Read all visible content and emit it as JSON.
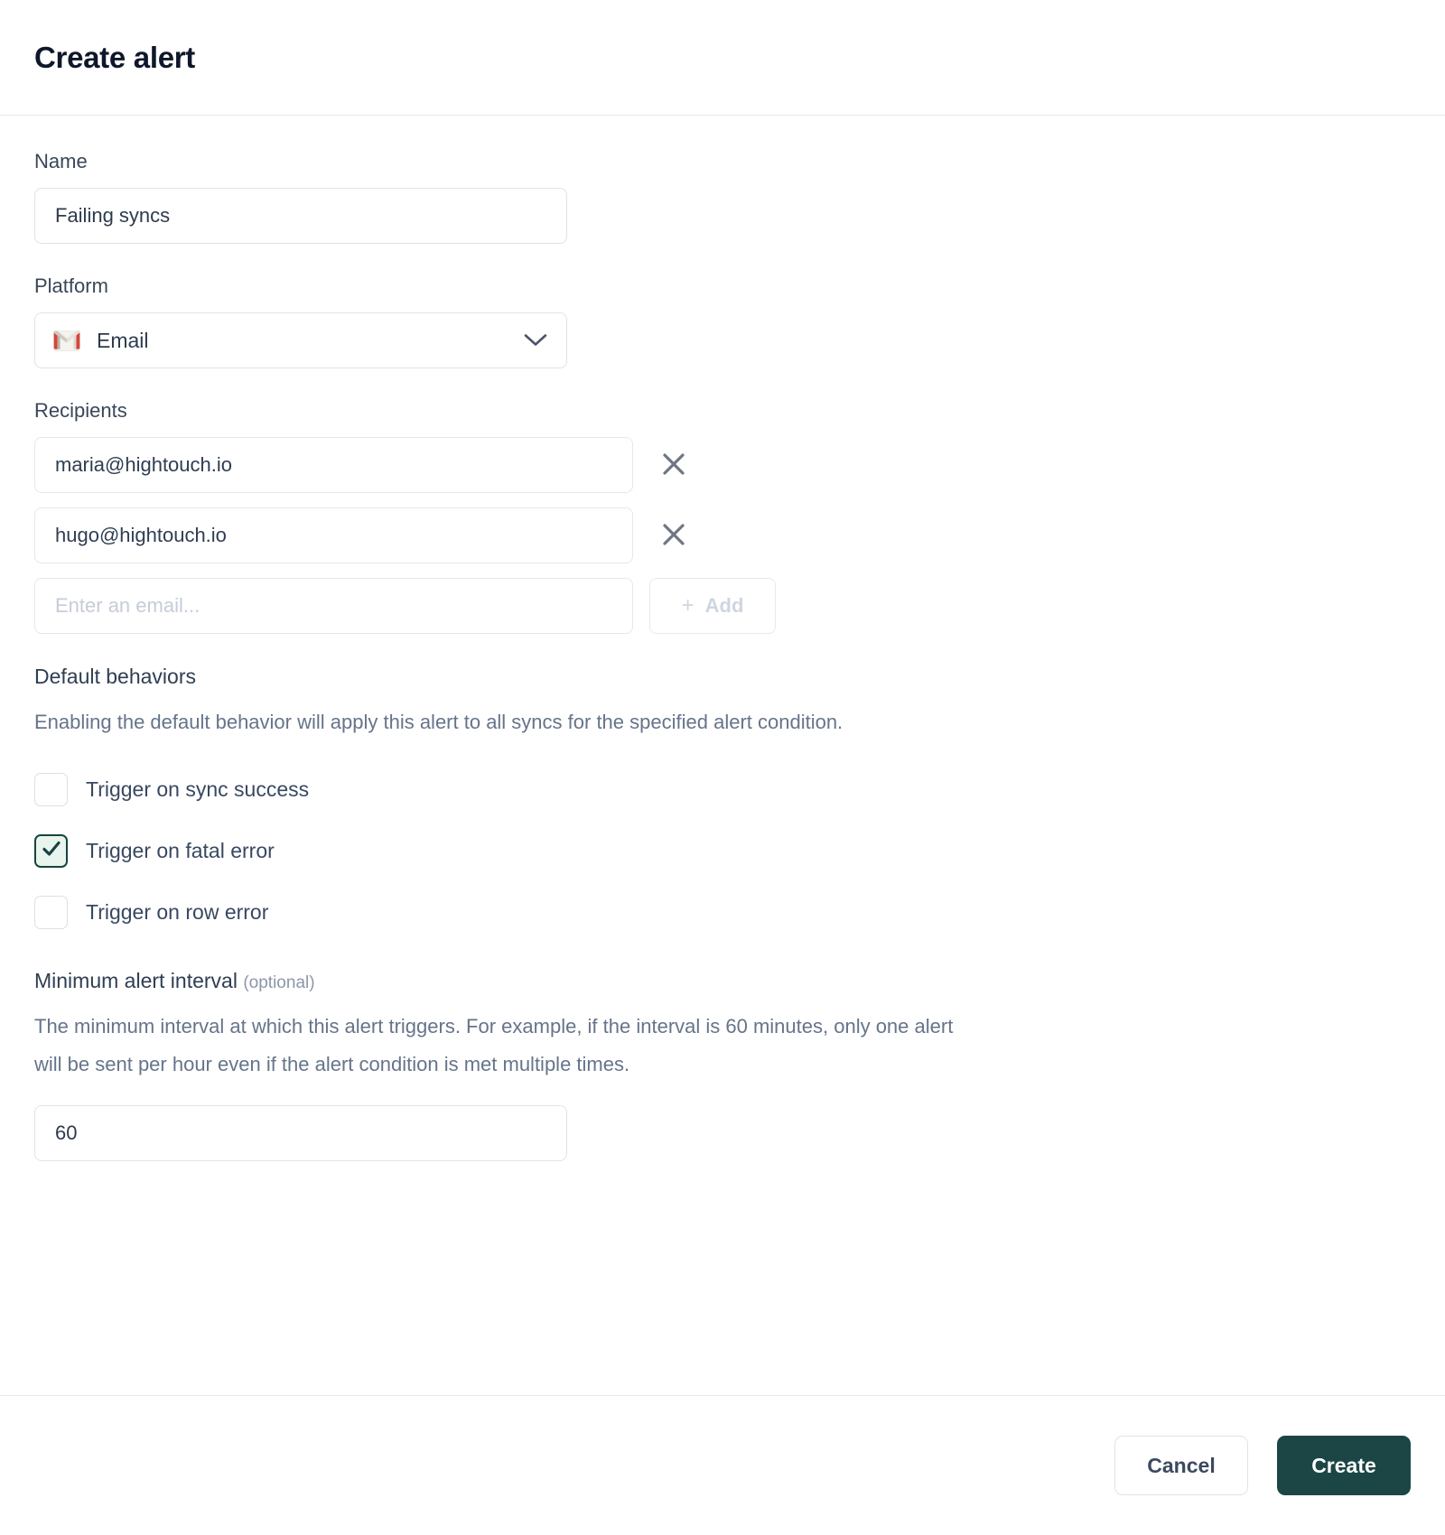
{
  "header": {
    "title": "Create alert"
  },
  "form": {
    "name": {
      "label": "Name",
      "value": "Failing syncs"
    },
    "platform": {
      "label": "Platform",
      "selected": "Email",
      "icon": "gmail-icon",
      "chevron": "chevron-down-icon"
    },
    "recipients": {
      "label": "Recipients",
      "items": [
        {
          "email": "maria@hightouch.io",
          "remove": "×"
        },
        {
          "email": "hugo@hightouch.io",
          "remove": "×"
        }
      ],
      "new_placeholder": "Enter an email...",
      "new_value": "",
      "add_label": "Add",
      "add_plus": "+"
    },
    "default_behaviors": {
      "title": "Default behaviors",
      "description": "Enabling the default behavior will apply this alert to all syncs for the specified alert condition.",
      "options": [
        {
          "label": "Trigger on sync success",
          "checked": false
        },
        {
          "label": "Trigger on fatal error",
          "checked": true
        },
        {
          "label": "Trigger on row error",
          "checked": false
        }
      ]
    },
    "minimum_interval": {
      "title": "Minimum alert interval",
      "optional_tag": "(optional)",
      "description": "The minimum interval at which this alert triggers. For example, if the interval is 60 minutes, only one alert will be sent per hour even if the alert condition is met multiple times.",
      "value": "60"
    }
  },
  "footer": {
    "cancel_label": "Cancel",
    "create_label": "Create"
  },
  "colors": {
    "accent": "#1c4645",
    "checked_bg": "#e9f4ee",
    "border": "#dfe3ea",
    "text": "#2d3b4e",
    "muted": "#66748a"
  }
}
